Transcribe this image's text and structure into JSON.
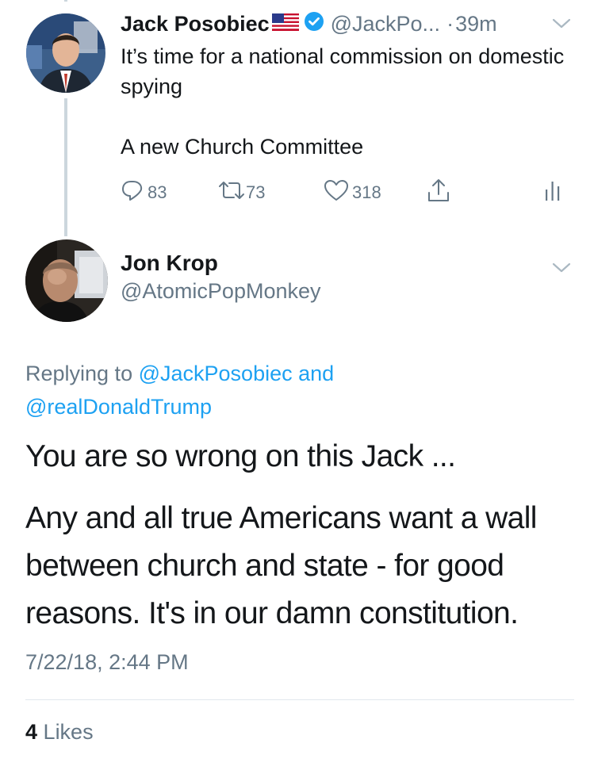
{
  "parent_tweet": {
    "display_name": "Jack Posobiec",
    "flag_icon": "us-flag-icon",
    "verified_icon": "verified-badge-icon",
    "handle": "@JackPo...",
    "separator": "·",
    "time": "39m",
    "text_line_1": "It’s time for a national commission on domestic spying",
    "text_line_2": "A new Church Committee",
    "actions": {
      "reply_count": "83",
      "retweet_count": "73",
      "like_count": "318"
    }
  },
  "reply_tweet": {
    "display_name": "Jon Krop",
    "handle": "@AtomicPopMonkey",
    "replying_prefix": "Replying to",
    "replying_to_1": "@JackPosobiec",
    "replying_and": "and",
    "replying_to_2": "@realDonaldTrump",
    "text_paragraph_1": "You are so wrong on this Jack ...",
    "text_paragraph_2": "Any and all true Americans want a wall between church and state - for good reasons. It's in our damn constitution.",
    "timestamp": "7/22/18, 2:44 PM",
    "likes_count": "4",
    "likes_label": "Likes"
  },
  "colors": {
    "primary_text": "#14171a",
    "secondary_text": "#657786",
    "link_blue": "#1da1f2",
    "divider": "#e1e8ed",
    "thread_line": "#ccd6dd"
  }
}
